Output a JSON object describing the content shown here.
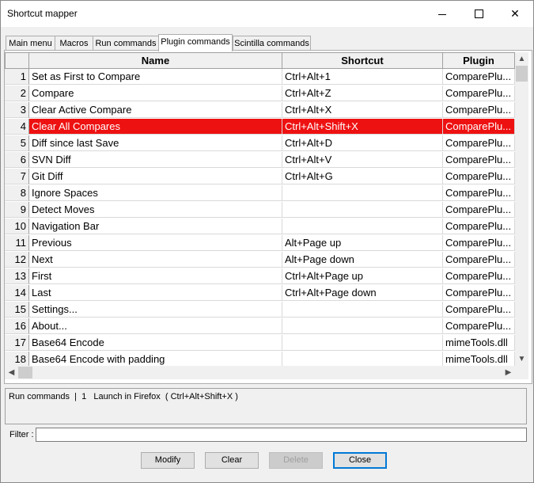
{
  "window": {
    "title": "Shortcut mapper"
  },
  "tabs": [
    {
      "label": "Main menu"
    },
    {
      "label": "Macros"
    },
    {
      "label": "Run commands"
    },
    {
      "label": "Plugin commands"
    },
    {
      "label": "Scintilla commands"
    }
  ],
  "active_tab": "Plugin commands",
  "table": {
    "headers": {
      "name": "Name",
      "shortcut": "Shortcut",
      "plugin": "Plugin"
    },
    "rows": [
      {
        "num": "1",
        "name": "Set as First to Compare",
        "shortcut": "Ctrl+Alt+1",
        "plugin": "ComparePlu..."
      },
      {
        "num": "2",
        "name": "Compare",
        "shortcut": "Ctrl+Alt+Z",
        "plugin": "ComparePlu..."
      },
      {
        "num": "3",
        "name": "Clear Active Compare",
        "shortcut": "Ctrl+Alt+X",
        "plugin": "ComparePlu..."
      },
      {
        "num": "4",
        "name": "Clear All Compares",
        "shortcut": "Ctrl+Alt+Shift+X",
        "plugin": "ComparePlu..."
      },
      {
        "num": "5",
        "name": "Diff since last Save",
        "shortcut": "Ctrl+Alt+D",
        "plugin": "ComparePlu..."
      },
      {
        "num": "6",
        "name": "SVN Diff",
        "shortcut": "Ctrl+Alt+V",
        "plugin": "ComparePlu..."
      },
      {
        "num": "7",
        "name": "Git Diff",
        "shortcut": "Ctrl+Alt+G",
        "plugin": "ComparePlu..."
      },
      {
        "num": "8",
        "name": "Ignore Spaces",
        "shortcut": "",
        "plugin": "ComparePlu..."
      },
      {
        "num": "9",
        "name": "Detect Moves",
        "shortcut": "",
        "plugin": "ComparePlu..."
      },
      {
        "num": "10",
        "name": "Navigation Bar",
        "shortcut": "",
        "plugin": "ComparePlu..."
      },
      {
        "num": "11",
        "name": "Previous",
        "shortcut": "Alt+Page up",
        "plugin": "ComparePlu..."
      },
      {
        "num": "12",
        "name": "Next",
        "shortcut": "Alt+Page down",
        "plugin": "ComparePlu..."
      },
      {
        "num": "13",
        "name": "First",
        "shortcut": "Ctrl+Alt+Page up",
        "plugin": "ComparePlu..."
      },
      {
        "num": "14",
        "name": "Last",
        "shortcut": "Ctrl+Alt+Page down",
        "plugin": "ComparePlu..."
      },
      {
        "num": "15",
        "name": "Settings...",
        "shortcut": "",
        "plugin": "ComparePlu..."
      },
      {
        "num": "16",
        "name": "About...",
        "shortcut": "",
        "plugin": "ComparePlu..."
      },
      {
        "num": "17",
        "name": "Base64 Encode",
        "shortcut": "",
        "plugin": "mimeTools.dll"
      },
      {
        "num": "18",
        "name": "Base64 Encode with padding",
        "shortcut": "",
        "plugin": "mimeTools.dll"
      }
    ],
    "selected_row": "4"
  },
  "status": {
    "text": "Run commands  |  1   Launch in Firefox  ( Ctrl+Alt+Shift+X )"
  },
  "filter": {
    "label": "Filter :",
    "value": ""
  },
  "buttons": {
    "modify": "Modify",
    "clear": "Clear",
    "delete": "Delete",
    "close": "Close"
  },
  "colors": {
    "selection": "#ee1111",
    "default_button_border": "#0078d7"
  },
  "icons": {
    "minimize": "minimize-icon",
    "maximize": "maximize-icon",
    "close": "close-icon"
  }
}
